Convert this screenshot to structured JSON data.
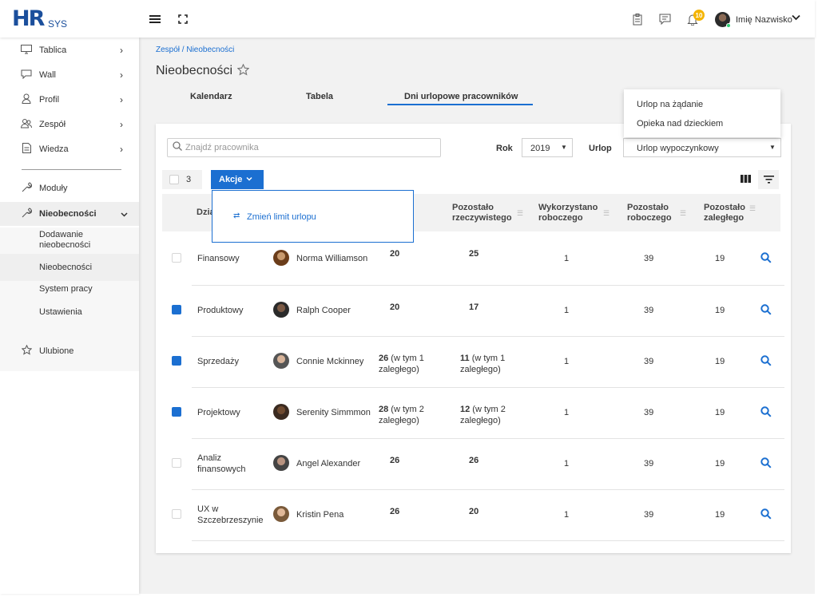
{
  "topbar": {
    "logo_hr": "HR",
    "logo_sys": "SYS",
    "notification_count": "10",
    "user_name": "Imię Nazwisko"
  },
  "sidebar": {
    "items": [
      {
        "label": "Tablica",
        "icon": "monitor-icon"
      },
      {
        "label": "Wall",
        "icon": "chat-icon"
      },
      {
        "label": "Profil",
        "icon": "user-icon"
      },
      {
        "label": "Zespół",
        "icon": "team-icon"
      },
      {
        "label": "Wiedza",
        "icon": "document-icon"
      },
      {
        "label": "Moduły",
        "icon": "wrench-icon"
      },
      {
        "label": "Nieobecności",
        "icon": "wrench-icon"
      }
    ],
    "sub_items": [
      {
        "label": "Dodawanie nieobecności"
      },
      {
        "label": "Nieobecności"
      },
      {
        "label": "System pracy"
      },
      {
        "label": "Ustawienia"
      }
    ],
    "favorites_label": "Ulubione"
  },
  "main": {
    "breadcrumb": "Zespół / Nieobecności",
    "title": "Nieobecności",
    "tabs": [
      {
        "label": "Kalendarz"
      },
      {
        "label": "Tabela"
      },
      {
        "label": "Dni urlopowe pracowników"
      }
    ],
    "active_tab": "Dni urlopowe pracowników"
  },
  "filters": {
    "search_placeholder": "Znajdź pracownika",
    "year_label": "Rok",
    "year_value": "2019",
    "leave_label": "Urlop",
    "leave_value": "Urlop wypoczynkowy",
    "leave_options_open": [
      "Urlop na żądanie",
      "Opieka nad dzieckiem"
    ]
  },
  "toolbar": {
    "selected_count": "3",
    "actions_label": "Akcje",
    "actions_menu": [
      "Zmień limit urlopu"
    ]
  },
  "table": {
    "headers": {
      "dept_partial": "Dzia",
      "remaining_actual": "Pozostało rzeczywistego",
      "used_working": "Wykorzystano roboczego",
      "remaining_working": "Pozostało roboczego",
      "remaining_overdue": "Pozostało zaległego"
    },
    "rows": [
      {
        "checked": false,
        "dept": "Finansowy",
        "name": "Norma Williamson",
        "limit": "20",
        "limit_note": "",
        "remaining_actual": "25",
        "remaining_note": "",
        "used": "1",
        "remaining_working": "39",
        "overdue": "19"
      },
      {
        "checked": true,
        "dept": "Produktowy",
        "name": "Ralph Cooper",
        "limit": "20",
        "limit_note": "",
        "remaining_actual": "17",
        "remaining_note": "",
        "used": "1",
        "remaining_working": "39",
        "overdue": "19"
      },
      {
        "checked": true,
        "dept": "Sprzedaży",
        "name": "Connie Mckinney",
        "limit": "26",
        "limit_note": " (w tym 1 zaległego)",
        "remaining_actual": "11",
        "remaining_note": " (w tym 1 zaległego)",
        "used": "1",
        "remaining_working": "39",
        "overdue": "19"
      },
      {
        "checked": true,
        "dept": "Projektowy",
        "name": "Serenity Simmmon",
        "limit": "28",
        "limit_note": " (w tym 2 zaległego)",
        "remaining_actual": "12",
        "remaining_note": " (w tym 2 zaległego)",
        "used": "1",
        "remaining_working": "39",
        "overdue": "19"
      },
      {
        "checked": false,
        "dept": "Analiz finansowych",
        "name": "Angel Alexander",
        "limit": "26",
        "limit_note": "",
        "remaining_actual": "26",
        "remaining_note": "",
        "used": "1",
        "remaining_working": "39",
        "overdue": "19"
      },
      {
        "checked": false,
        "dept": "UX w Szczebrzeszynie",
        "name": "Kristin Pena",
        "limit": "26",
        "limit_note": "",
        "remaining_actual": "20",
        "remaining_note": "",
        "used": "1",
        "remaining_working": "39",
        "overdue": "19"
      }
    ]
  },
  "colors": {
    "accent": "#1b6fd1",
    "logo": "#1b4f9c",
    "badge": "#f4b400"
  }
}
